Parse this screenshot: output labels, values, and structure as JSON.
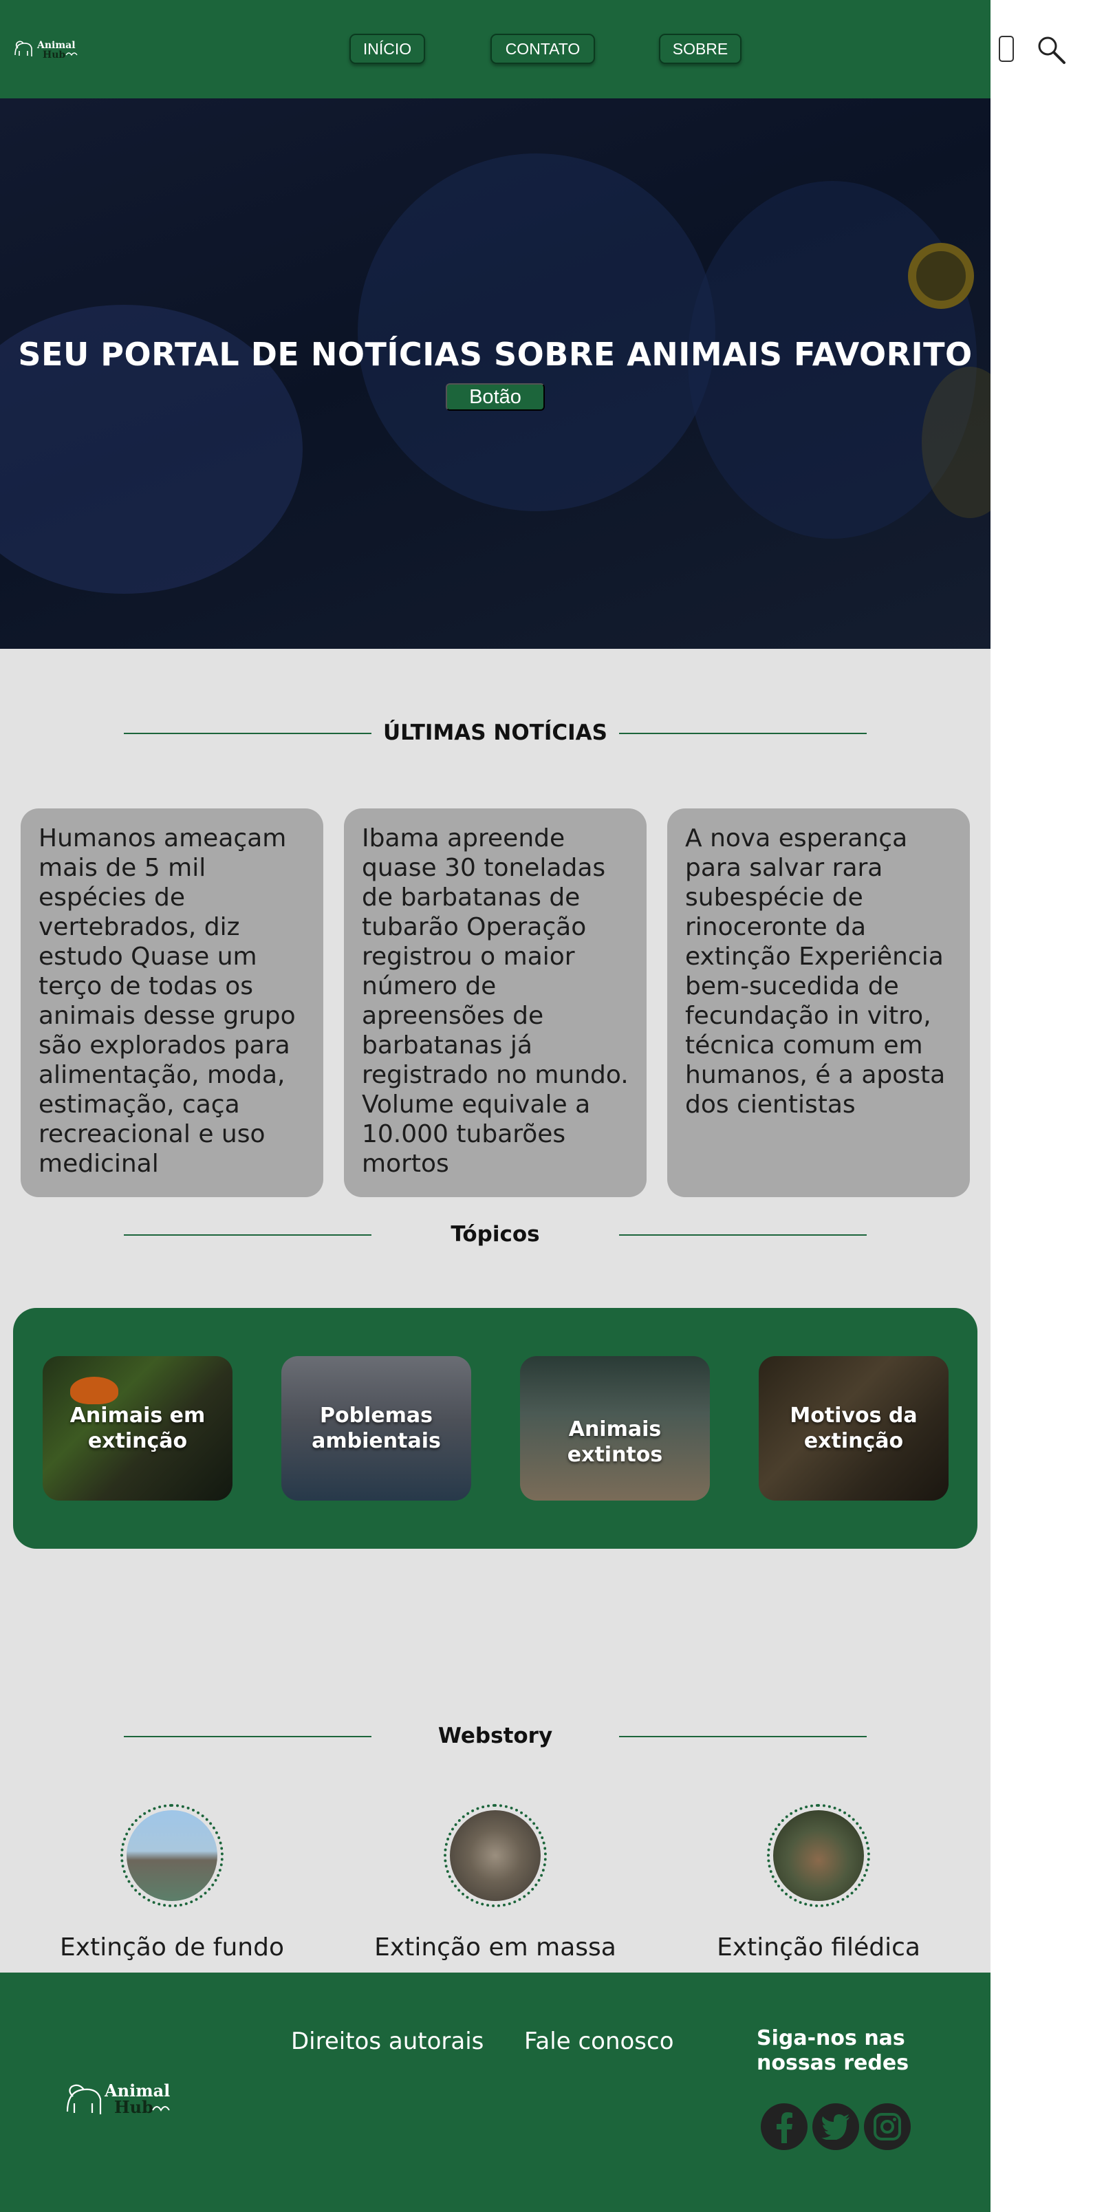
{
  "header": {
    "logo_text_line1": "Animal",
    "logo_text_line2": "Hub",
    "nav": [
      {
        "label": "INÍCIO"
      },
      {
        "label": "CONTATO"
      },
      {
        "label": "SOBRE"
      }
    ]
  },
  "hero": {
    "title": "SEU PORTAL DE NOTÍCIAS SOBRE ANIMAIS FAVORITO",
    "button_label": "Botão"
  },
  "news": {
    "heading": "ÚLTIMAS NOTÍCIAS",
    "items": [
      {
        "text": "Humanos ameaçam mais de 5 mil espécies de vertebrados, diz estudo Quase um terço de todas os animais desse grupo são explorados para alimentação, moda, estimação, caça recreacional e uso medicinal"
      },
      {
        "text": "Ibama apreende quase 30 toneladas de barbatanas de tubarão Operação registrou o maior número de apreensões de barbatanas já registrado no mundo. Volume equivale a 10.000 tubarões mortos"
      },
      {
        "text": "A nova esperança para salvar rara subespécie de rinoceronte da extinção Experiência bem-sucedida de fecundação in vitro, técnica comum em humanos, é a aposta dos cientistas"
      }
    ]
  },
  "topics": {
    "heading": "Tópicos",
    "items": [
      {
        "label": "Animais em extinção"
      },
      {
        "label": "Poblemas ambientais"
      },
      {
        "label": "Animais extintos"
      },
      {
        "label": "Motivos da extinção"
      }
    ]
  },
  "webstory": {
    "heading": "Webstory",
    "items": [
      {
        "label": "Extinção de fundo"
      },
      {
        "label": "Extinção em massa"
      },
      {
        "label": "Extinção filédica"
      }
    ]
  },
  "footer": {
    "links": [
      {
        "label": "Direitos autorais"
      },
      {
        "label": "Fale conosco"
      }
    ],
    "follow_title": "Siga-nos nas nossas redes",
    "social_icons": [
      "facebook-icon",
      "twitter-icon",
      "instagram-icon"
    ]
  },
  "colors": {
    "brand_green": "#1c653b",
    "page_bg": "#e2e2e2",
    "card_gray": "#a9a9a9"
  }
}
